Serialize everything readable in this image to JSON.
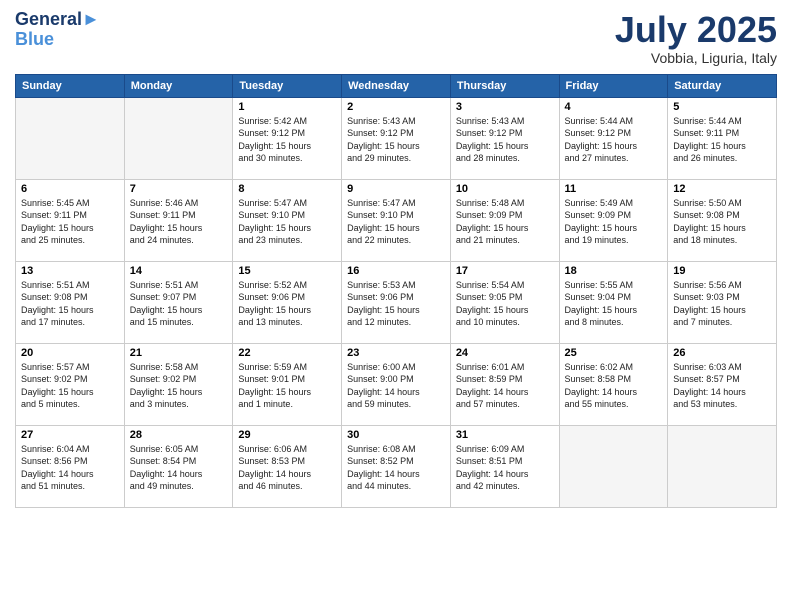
{
  "header": {
    "logo_line1": "General",
    "logo_line2": "Blue",
    "month": "July 2025",
    "location": "Vobbia, Liguria, Italy"
  },
  "weekdays": [
    "Sunday",
    "Monday",
    "Tuesday",
    "Wednesday",
    "Thursday",
    "Friday",
    "Saturday"
  ],
  "weeks": [
    [
      {
        "day": "",
        "info": ""
      },
      {
        "day": "",
        "info": ""
      },
      {
        "day": "1",
        "info": "Sunrise: 5:42 AM\nSunset: 9:12 PM\nDaylight: 15 hours\nand 30 minutes."
      },
      {
        "day": "2",
        "info": "Sunrise: 5:43 AM\nSunset: 9:12 PM\nDaylight: 15 hours\nand 29 minutes."
      },
      {
        "day": "3",
        "info": "Sunrise: 5:43 AM\nSunset: 9:12 PM\nDaylight: 15 hours\nand 28 minutes."
      },
      {
        "day": "4",
        "info": "Sunrise: 5:44 AM\nSunset: 9:12 PM\nDaylight: 15 hours\nand 27 minutes."
      },
      {
        "day": "5",
        "info": "Sunrise: 5:44 AM\nSunset: 9:11 PM\nDaylight: 15 hours\nand 26 minutes."
      }
    ],
    [
      {
        "day": "6",
        "info": "Sunrise: 5:45 AM\nSunset: 9:11 PM\nDaylight: 15 hours\nand 25 minutes."
      },
      {
        "day": "7",
        "info": "Sunrise: 5:46 AM\nSunset: 9:11 PM\nDaylight: 15 hours\nand 24 minutes."
      },
      {
        "day": "8",
        "info": "Sunrise: 5:47 AM\nSunset: 9:10 PM\nDaylight: 15 hours\nand 23 minutes."
      },
      {
        "day": "9",
        "info": "Sunrise: 5:47 AM\nSunset: 9:10 PM\nDaylight: 15 hours\nand 22 minutes."
      },
      {
        "day": "10",
        "info": "Sunrise: 5:48 AM\nSunset: 9:09 PM\nDaylight: 15 hours\nand 21 minutes."
      },
      {
        "day": "11",
        "info": "Sunrise: 5:49 AM\nSunset: 9:09 PM\nDaylight: 15 hours\nand 19 minutes."
      },
      {
        "day": "12",
        "info": "Sunrise: 5:50 AM\nSunset: 9:08 PM\nDaylight: 15 hours\nand 18 minutes."
      }
    ],
    [
      {
        "day": "13",
        "info": "Sunrise: 5:51 AM\nSunset: 9:08 PM\nDaylight: 15 hours\nand 17 minutes."
      },
      {
        "day": "14",
        "info": "Sunrise: 5:51 AM\nSunset: 9:07 PM\nDaylight: 15 hours\nand 15 minutes."
      },
      {
        "day": "15",
        "info": "Sunrise: 5:52 AM\nSunset: 9:06 PM\nDaylight: 15 hours\nand 13 minutes."
      },
      {
        "day": "16",
        "info": "Sunrise: 5:53 AM\nSunset: 9:06 PM\nDaylight: 15 hours\nand 12 minutes."
      },
      {
        "day": "17",
        "info": "Sunrise: 5:54 AM\nSunset: 9:05 PM\nDaylight: 15 hours\nand 10 minutes."
      },
      {
        "day": "18",
        "info": "Sunrise: 5:55 AM\nSunset: 9:04 PM\nDaylight: 15 hours\nand 8 minutes."
      },
      {
        "day": "19",
        "info": "Sunrise: 5:56 AM\nSunset: 9:03 PM\nDaylight: 15 hours\nand 7 minutes."
      }
    ],
    [
      {
        "day": "20",
        "info": "Sunrise: 5:57 AM\nSunset: 9:02 PM\nDaylight: 15 hours\nand 5 minutes."
      },
      {
        "day": "21",
        "info": "Sunrise: 5:58 AM\nSunset: 9:02 PM\nDaylight: 15 hours\nand 3 minutes."
      },
      {
        "day": "22",
        "info": "Sunrise: 5:59 AM\nSunset: 9:01 PM\nDaylight: 15 hours\nand 1 minute."
      },
      {
        "day": "23",
        "info": "Sunrise: 6:00 AM\nSunset: 9:00 PM\nDaylight: 14 hours\nand 59 minutes."
      },
      {
        "day": "24",
        "info": "Sunrise: 6:01 AM\nSunset: 8:59 PM\nDaylight: 14 hours\nand 57 minutes."
      },
      {
        "day": "25",
        "info": "Sunrise: 6:02 AM\nSunset: 8:58 PM\nDaylight: 14 hours\nand 55 minutes."
      },
      {
        "day": "26",
        "info": "Sunrise: 6:03 AM\nSunset: 8:57 PM\nDaylight: 14 hours\nand 53 minutes."
      }
    ],
    [
      {
        "day": "27",
        "info": "Sunrise: 6:04 AM\nSunset: 8:56 PM\nDaylight: 14 hours\nand 51 minutes."
      },
      {
        "day": "28",
        "info": "Sunrise: 6:05 AM\nSunset: 8:54 PM\nDaylight: 14 hours\nand 49 minutes."
      },
      {
        "day": "29",
        "info": "Sunrise: 6:06 AM\nSunset: 8:53 PM\nDaylight: 14 hours\nand 46 minutes."
      },
      {
        "day": "30",
        "info": "Sunrise: 6:08 AM\nSunset: 8:52 PM\nDaylight: 14 hours\nand 44 minutes."
      },
      {
        "day": "31",
        "info": "Sunrise: 6:09 AM\nSunset: 8:51 PM\nDaylight: 14 hours\nand 42 minutes."
      },
      {
        "day": "",
        "info": ""
      },
      {
        "day": "",
        "info": ""
      }
    ]
  ]
}
